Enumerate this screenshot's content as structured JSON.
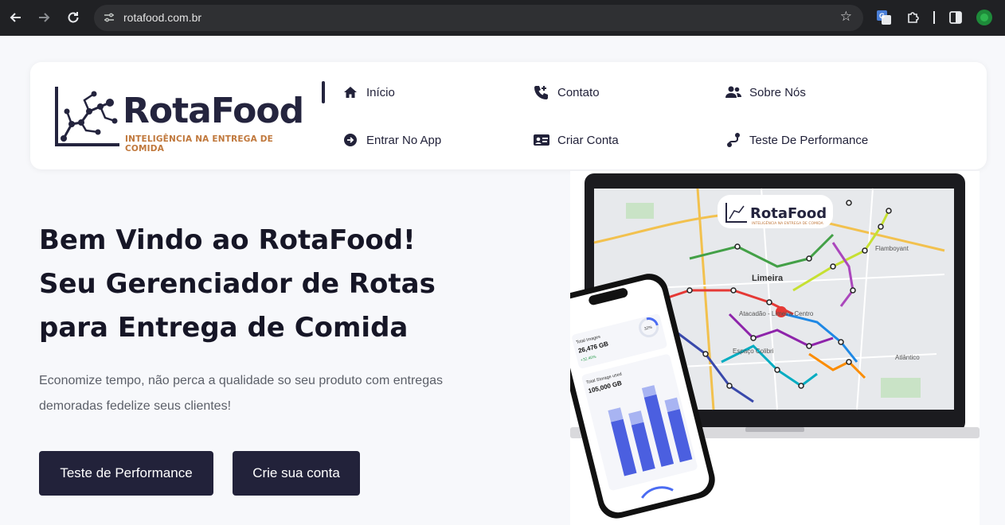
{
  "browser": {
    "url": "rotafood.com.br",
    "back_icon": "arrow-back-icon",
    "forward_icon": "arrow-forward-icon",
    "reload_icon": "reload-icon"
  },
  "brand": {
    "name": "RotaFood",
    "tagline": "INTELIGÊNCIA NA ENTREGA DE COMIDA"
  },
  "nav": {
    "items": [
      {
        "label": "Início",
        "icon": "home-icon"
      },
      {
        "label": "Contato",
        "icon": "phone-icon"
      },
      {
        "label": "Sobre Nós",
        "icon": "users-icon"
      },
      {
        "label": "Entrar No App",
        "icon": "sign-in-icon"
      },
      {
        "label": "Criar Conta",
        "icon": "id-card-icon"
      },
      {
        "label": "Teste De Performance",
        "icon": "route-icon"
      }
    ]
  },
  "hero": {
    "title_lines": [
      "Bem Vindo ao RotaFood!",
      "Seu Gerenciador de Rotas",
      "para Entrega de Comida"
    ],
    "description": "Economize tempo, não perca a qualidade so seu produto com entregas demoradas fedelize seus clientes!",
    "primary_button": "Teste de Performance",
    "secondary_button": "Crie sua conta"
  },
  "illustration": {
    "logo_text": "RotaFood",
    "logo_sub": "INTELIGÊNCIA NA ENTREGA DE COMIDA",
    "map_labels": [
      "Limeira",
      "Flamboyant",
      "Atlântico",
      "Espaço Colibri",
      "Atacadão - Limeira Centro"
    ],
    "phone": {
      "percent": "32%",
      "total_images_label": "Total Images",
      "total_images_value": "26,476 GB",
      "storage_label": "Total Storage used",
      "storage_value": "105,000 GB",
      "growth": "+32.40%"
    }
  },
  "colors": {
    "primary": "#22223a",
    "accent": "#c0783c",
    "background": "#f7f8fb"
  }
}
